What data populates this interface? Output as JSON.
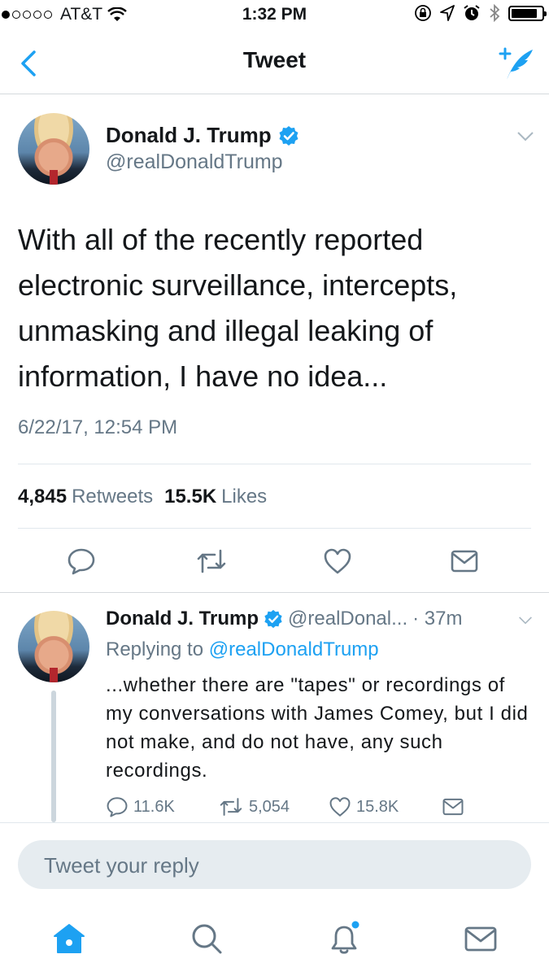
{
  "status_bar": {
    "carrier": "AT&T",
    "time": "1:32 PM",
    "signal_bars_filled": 1,
    "signal_bars_total": 5,
    "battery_level": 0.85
  },
  "nav": {
    "title": "Tweet",
    "back_icon": "chevron-left-icon",
    "compose_icon": "compose-tweet-icon"
  },
  "main_tweet": {
    "author_name": "Donald J. Trump",
    "author_handle": "@realDonaldTrump",
    "verified": true,
    "text": "With all of the recently reported electronic surveillance, intercepts, unmasking and illegal leaking of information, I have no idea...",
    "timestamp": "6/22/17, 12:54 PM",
    "retweets_count": "4,845",
    "retweets_label": "Retweets",
    "likes_count": "15.5K",
    "likes_label": "Likes"
  },
  "reply_tweet": {
    "author_name": "Donald J. Trump",
    "author_handle": "@realDonal...",
    "time_ago": "· 37m",
    "replying_prefix": "Replying to",
    "replying_to": "@realDonaldTrump",
    "text": "...whether there are \"tapes\" or recordings of my conversations with James Comey, but I did not make, and do not have, any such recordings.",
    "reply_count": "11.6K",
    "retweet_count": "5,054",
    "like_count": "15.8K"
  },
  "composer": {
    "placeholder": "Tweet your reply"
  },
  "tab_bar": {
    "tabs": [
      "home-icon",
      "search-icon",
      "notifications-icon",
      "messages-icon"
    ],
    "active": "home-icon",
    "notification_dot": true
  },
  "colors": {
    "accent": "#1da1f2",
    "secondary_text": "#657786",
    "divider": "#e1e8ed",
    "icon_gray": "#657786"
  }
}
